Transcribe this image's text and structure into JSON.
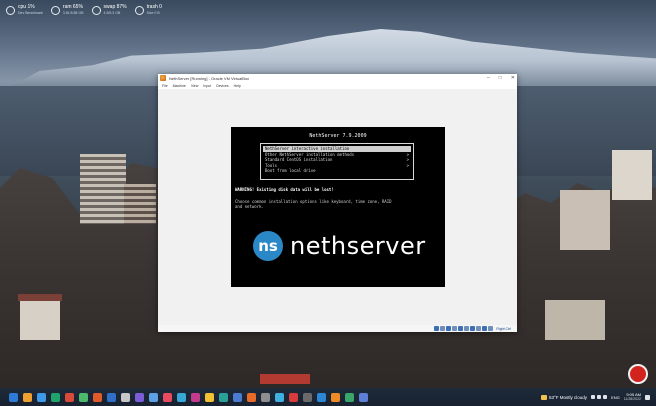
{
  "widgets": [
    {
      "main": "cpu 1%",
      "sub": "Dev Benchmark"
    },
    {
      "main": "ram 65%",
      "sub": "3.81/5.85 GB"
    },
    {
      "main": "swap 87%",
      "sub": "4.5/5.3 GB"
    },
    {
      "main": "trash 0",
      "sub": "Size 0 B"
    }
  ],
  "window": {
    "title": "NethServer [Running] - Oracle VM VirtualBox",
    "controls": [
      "–",
      "□",
      "✕"
    ],
    "menus": [
      "File",
      "Machine",
      "View",
      "Input",
      "Devices",
      "Help"
    ],
    "host_key": "Right Ctrl"
  },
  "console": {
    "title": "NethServer 7.9.2009",
    "menu": [
      {
        "label": "NethServer interactive installation",
        "arrow": "",
        "selected": true
      },
      {
        "label": "Other NethServer installation methods",
        "arrow": ">",
        "selected": false
      },
      {
        "label": "Standard CentOS installation",
        "arrow": ">",
        "selected": false
      },
      {
        "label": "Tools",
        "arrow": ">",
        "selected": false
      },
      {
        "label": "Boot from local drive",
        "arrow": "",
        "selected": false
      }
    ],
    "warning": "WARNING! Existing disk data will be lost!",
    "help": "Choose common installation options like keyboard, time zone, RAID and network.",
    "logo_mark": "ns",
    "logo_text": "nethserver"
  },
  "taskbar": {
    "weather": "53°F Mostly cloudy",
    "lang": "ENG",
    "time": "9:05 AM",
    "date": "11/28/2022",
    "app_colors": [
      "#2d7ad8",
      "#f0a030",
      "#3b9be8",
      "#1ea36c",
      "#d94a38",
      "#4bb86b",
      "#e05a2a",
      "#2f6fc8",
      "#c6c6c6",
      "#7b5bd6",
      "#5da0e6",
      "#e84a5f",
      "#37a7d6",
      "#c23a8e",
      "#f2c033",
      "#2aa198",
      "#4a7bd0",
      "#e66b2a",
      "#8e8e8e",
      "#3fb0e0",
      "#d83b3b",
      "#6a6a6a",
      "#2c86d3",
      "#f08a24",
      "#38a66a",
      "#5d7fd8"
    ]
  }
}
